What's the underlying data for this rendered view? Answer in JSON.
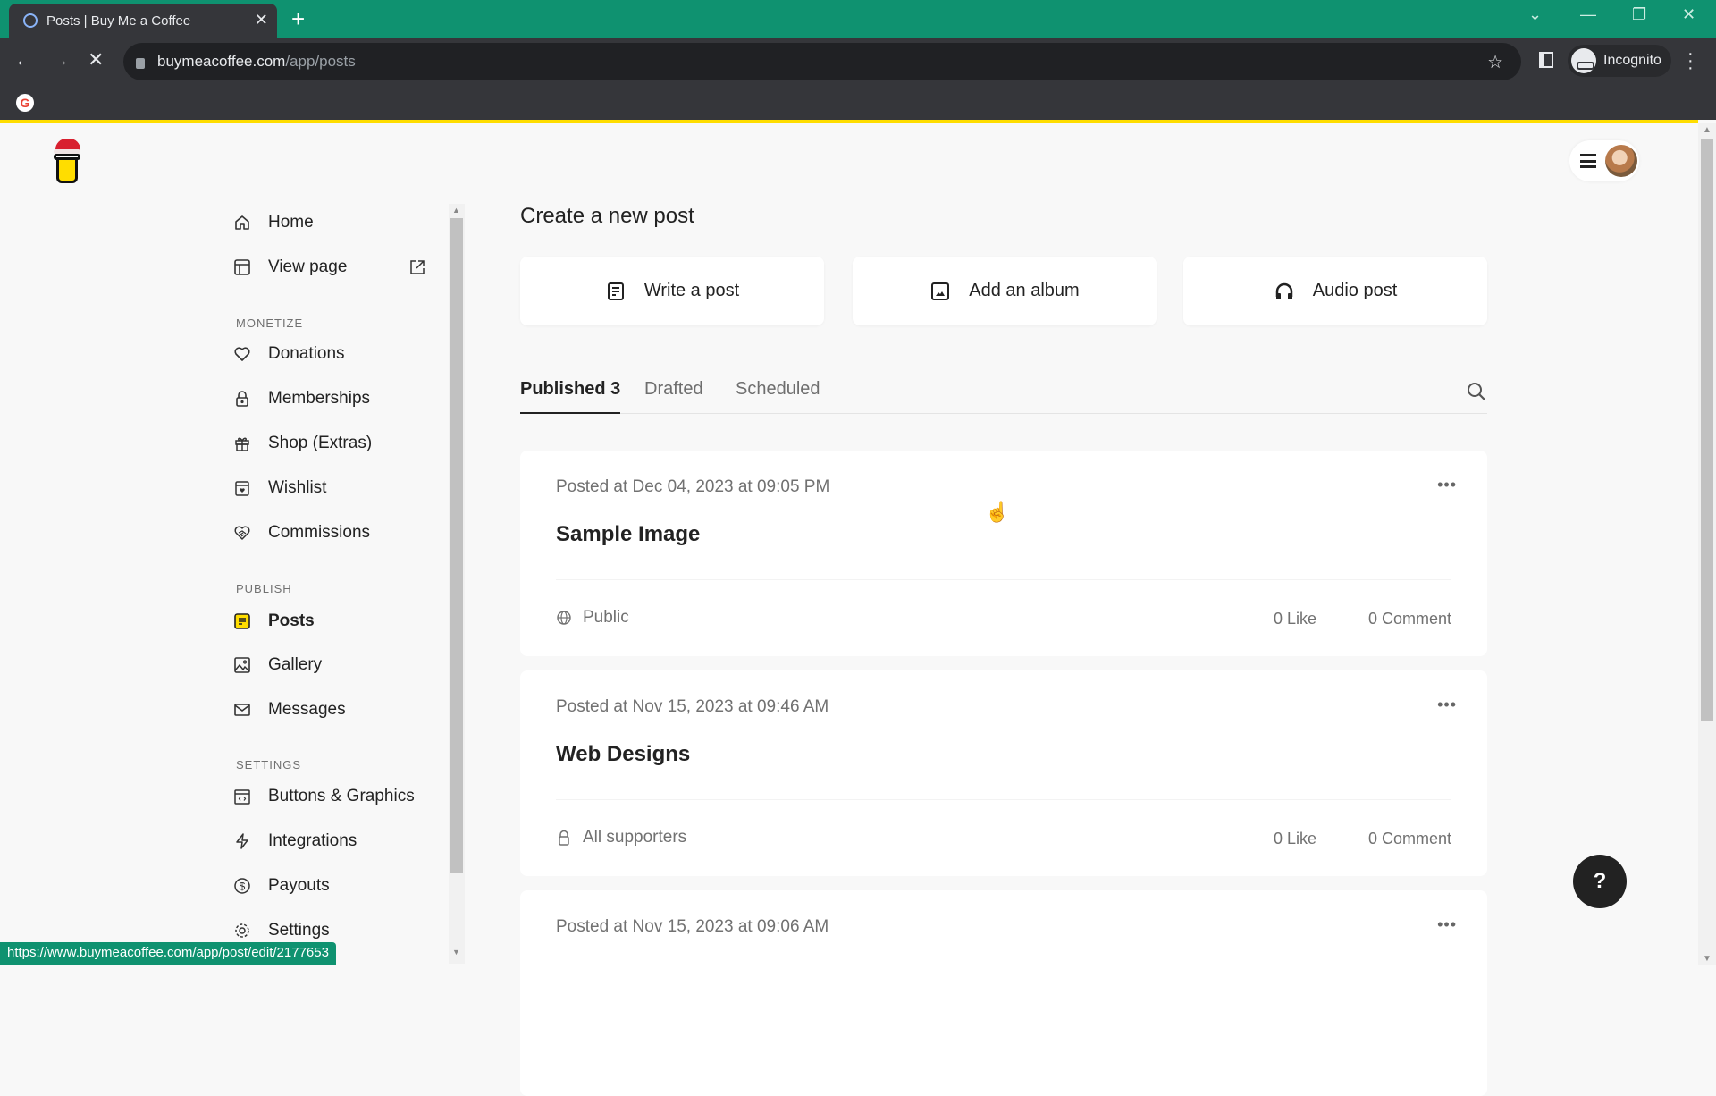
{
  "browser": {
    "tab_title": "Posts | Buy Me a Coffee",
    "url_host": "buymeacoffee.com",
    "url_path": "/app/posts",
    "profile_label": "Incognito",
    "status_url": "https://www.buymeacoffee.com/app/post/edit/2177653"
  },
  "sidebar": {
    "items_top": [
      {
        "label": "Home",
        "icon": "home-icon"
      },
      {
        "label": "View page",
        "icon": "layout-icon"
      }
    ],
    "sections": [
      {
        "title": "MONETIZE",
        "items": [
          {
            "label": "Donations",
            "icon": "heart-icon"
          },
          {
            "label": "Memberships",
            "icon": "lock-heart-icon"
          },
          {
            "label": "Shop (Extras)",
            "icon": "gift-icon"
          },
          {
            "label": "Wishlist",
            "icon": "calendar-heart-icon"
          },
          {
            "label": "Commissions",
            "icon": "handshake-icon"
          }
        ]
      },
      {
        "title": "PUBLISH",
        "items": [
          {
            "label": "Posts",
            "icon": "posts-icon",
            "active": true
          },
          {
            "label": "Gallery",
            "icon": "gallery-icon"
          },
          {
            "label": "Messages",
            "icon": "mail-icon"
          }
        ]
      },
      {
        "title": "SETTINGS",
        "items": [
          {
            "label": "Buttons & Graphics",
            "icon": "code-window-icon"
          },
          {
            "label": "Integrations",
            "icon": "lightning-icon"
          },
          {
            "label": "Payouts",
            "icon": "dollar-icon"
          },
          {
            "label": "Settings",
            "icon": "gear-icon"
          }
        ]
      }
    ]
  },
  "main": {
    "create_title": "Create a new post",
    "create_options": [
      {
        "label": "Write a post",
        "icon": "document-icon"
      },
      {
        "label": "Add an album",
        "icon": "image-icon"
      },
      {
        "label": "Audio post",
        "icon": "headphones-icon"
      }
    ],
    "tabs": [
      {
        "label": "Published 3",
        "active": true
      },
      {
        "label": "Drafted"
      },
      {
        "label": "Scheduled"
      }
    ],
    "posts": [
      {
        "date": "Posted at Dec 04, 2023 at 09:05 PM",
        "title": "Sample Image",
        "visibility": "Public",
        "visibility_icon": "globe-icon",
        "likes": "0 Like",
        "comments": "0 Comment"
      },
      {
        "date": "Posted at Nov 15, 2023 at 09:46 AM",
        "title": "Web Designs",
        "visibility": "All supporters",
        "visibility_icon": "lock-icon",
        "likes": "0 Like",
        "comments": "0 Comment"
      },
      {
        "date": "Posted at Nov 15, 2023 at 09:06 AM"
      }
    ]
  },
  "help_label": "?",
  "colors": {
    "brand_yellow": "#ffdd00",
    "chrome_green": "#0f9270",
    "text_dark": "#222222",
    "text_muted": "#717171"
  }
}
